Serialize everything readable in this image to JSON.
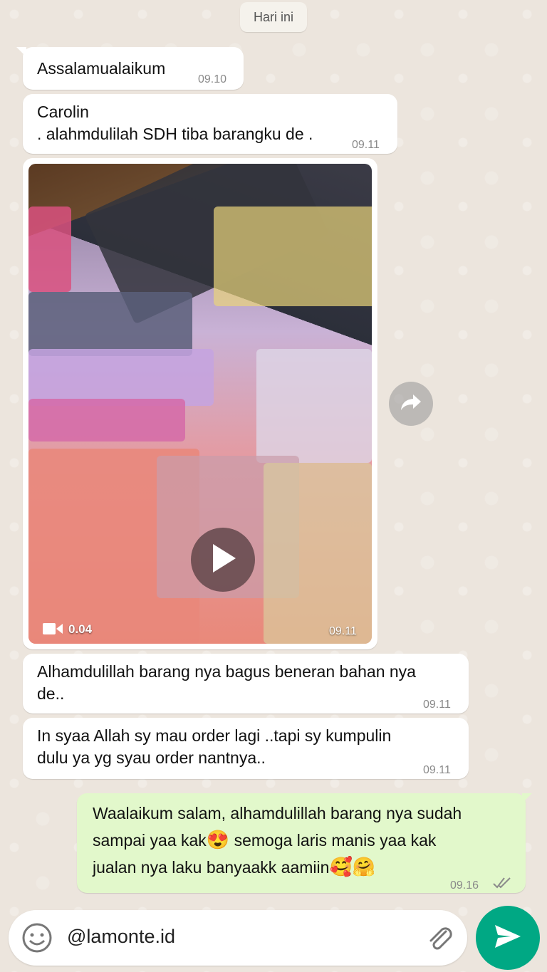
{
  "date_chip": "Hari ini",
  "messages": [
    {
      "text": "Assalamualaikum",
      "time": "09.10"
    },
    {
      "text": "Carolin\n. alahmdulilah SDH tiba barangku de .",
      "time": "09.11"
    },
    {
      "video_duration": "0.04",
      "time": "09.11"
    },
    {
      "text": "Alhamdulillah barang nya bagus beneran bahan nya\nde..",
      "time": "09.11"
    },
    {
      "text": "In syaa Allah sy mau order lagi ..tapi sy kumpulin\ndulu ya yg syau order nantnya..",
      "time": "09.11"
    },
    {
      "line1": "Waalaikum salam, alhamdulillah barang nya sudah",
      "line2a": "sampai yaa kak",
      "emoji1": "😍",
      "line2b": " semoga laris manis yaa kak",
      "line3": "jualan nya laku banyaakk aamiin",
      "emoji2": "🥰🤗",
      "time": "09.16"
    }
  ],
  "composer": {
    "text": "@lamonte.id"
  },
  "icons": {
    "emoji": "emoji-icon",
    "attach": "paperclip-icon",
    "send": "send-icon",
    "play": "play-icon",
    "forward": "forward-icon",
    "video": "video-camera-icon",
    "ticks": "double-check-icon"
  },
  "colors": {
    "background": "#ece5dd",
    "incoming": "#ffffff",
    "outgoing": "#e2f8cb",
    "send_button": "#00a884"
  }
}
